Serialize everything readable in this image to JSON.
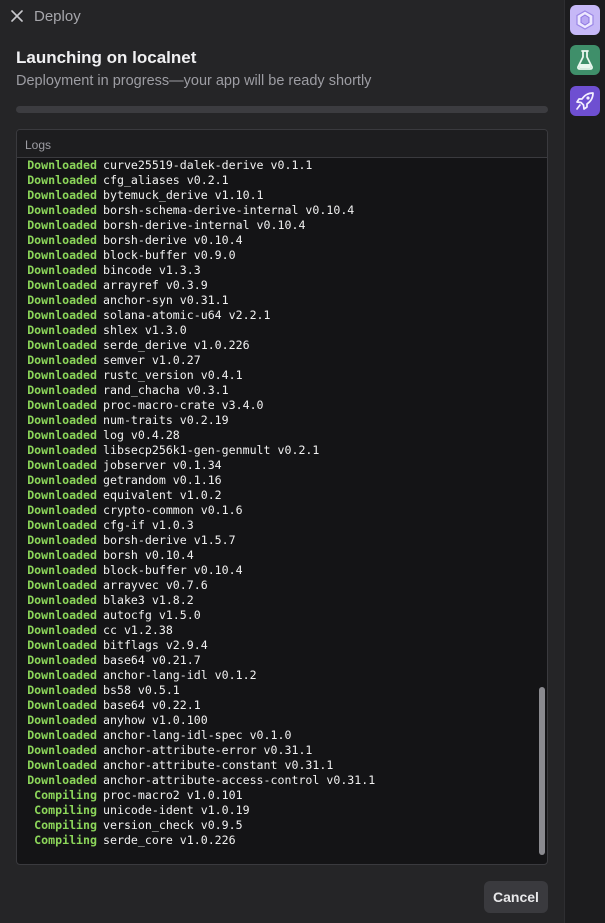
{
  "header": {
    "title": "Deploy"
  },
  "main": {
    "title": "Launching on localnet",
    "subtitle": "Deployment in progress—your app will be ready shortly",
    "progress": 0.0
  },
  "logs": {
    "label": "Logs",
    "lines": [
      {
        "kind": "Downloaded",
        "text": "curve25519-dalek-derive v0.1.1"
      },
      {
        "kind": "Downloaded",
        "text": "cfg_aliases v0.2.1"
      },
      {
        "kind": "Downloaded",
        "text": "bytemuck_derive v1.10.1"
      },
      {
        "kind": "Downloaded",
        "text": "borsh-schema-derive-internal v0.10.4"
      },
      {
        "kind": "Downloaded",
        "text": "borsh-derive-internal v0.10.4"
      },
      {
        "kind": "Downloaded",
        "text": "borsh-derive v0.10.4"
      },
      {
        "kind": "Downloaded",
        "text": "block-buffer v0.9.0"
      },
      {
        "kind": "Downloaded",
        "text": "bincode v1.3.3"
      },
      {
        "kind": "Downloaded",
        "text": "arrayref v0.3.9"
      },
      {
        "kind": "Downloaded",
        "text": "anchor-syn v0.31.1"
      },
      {
        "kind": "Downloaded",
        "text": "solana-atomic-u64 v2.2.1"
      },
      {
        "kind": "Downloaded",
        "text": "shlex v1.3.0"
      },
      {
        "kind": "Downloaded",
        "text": "serde_derive v1.0.226"
      },
      {
        "kind": "Downloaded",
        "text": "semver v1.0.27"
      },
      {
        "kind": "Downloaded",
        "text": "rustc_version v0.4.1"
      },
      {
        "kind": "Downloaded",
        "text": "rand_chacha v0.3.1"
      },
      {
        "kind": "Downloaded",
        "text": "proc-macro-crate v3.4.0"
      },
      {
        "kind": "Downloaded",
        "text": "num-traits v0.2.19"
      },
      {
        "kind": "Downloaded",
        "text": "log v0.4.28"
      },
      {
        "kind": "Downloaded",
        "text": "libsecp256k1-gen-genmult v0.2.1"
      },
      {
        "kind": "Downloaded",
        "text": "jobserver v0.1.34"
      },
      {
        "kind": "Downloaded",
        "text": "getrandom v0.1.16"
      },
      {
        "kind": "Downloaded",
        "text": "equivalent v1.0.2"
      },
      {
        "kind": "Downloaded",
        "text": "crypto-common v0.1.6"
      },
      {
        "kind": "Downloaded",
        "text": "cfg-if v1.0.3"
      },
      {
        "kind": "Downloaded",
        "text": "borsh-derive v1.5.7"
      },
      {
        "kind": "Downloaded",
        "text": "borsh v0.10.4"
      },
      {
        "kind": "Downloaded",
        "text": "block-buffer v0.10.4"
      },
      {
        "kind": "Downloaded",
        "text": "arrayvec v0.7.6"
      },
      {
        "kind": "Downloaded",
        "text": "blake3 v1.8.2"
      },
      {
        "kind": "Downloaded",
        "text": "autocfg v1.5.0"
      },
      {
        "kind": "Downloaded",
        "text": "cc v1.2.38"
      },
      {
        "kind": "Downloaded",
        "text": "bitflags v2.9.4"
      },
      {
        "kind": "Downloaded",
        "text": "base64 v0.21.7"
      },
      {
        "kind": "Downloaded",
        "text": "anchor-lang-idl v0.1.2"
      },
      {
        "kind": "Downloaded",
        "text": "bs58 v0.5.1"
      },
      {
        "kind": "Downloaded",
        "text": "base64 v0.22.1"
      },
      {
        "kind": "Downloaded",
        "text": "anyhow v1.0.100"
      },
      {
        "kind": "Downloaded",
        "text": "anchor-lang-idl-spec v0.1.0"
      },
      {
        "kind": "Downloaded",
        "text": "anchor-attribute-error v0.31.1"
      },
      {
        "kind": "Downloaded",
        "text": "anchor-attribute-constant v0.31.1"
      },
      {
        "kind": "Downloaded",
        "text": "anchor-attribute-access-control v0.31.1"
      },
      {
        "kind": "Compiling",
        "text": "proc-macro2 v1.0.101"
      },
      {
        "kind": "Compiling",
        "text": "unicode-ident v1.0.19"
      },
      {
        "kind": "Compiling",
        "text": "version_check v0.9.5"
      },
      {
        "kind": "Compiling",
        "text": "serde_core v1.0.226"
      }
    ]
  },
  "footer": {
    "cancel_label": "Cancel"
  },
  "sidebar": {
    "icons": [
      "cube-icon",
      "flask-icon",
      "rocket-icon"
    ]
  },
  "colors": {
    "accent_green": "#8cd65a",
    "panel_bg": "#252527",
    "logs_bg": "#141416",
    "rocket_bg": "#6e4fd1",
    "flask_bg": "#3f8f6a",
    "cube_bg": "#c6b8f7"
  }
}
